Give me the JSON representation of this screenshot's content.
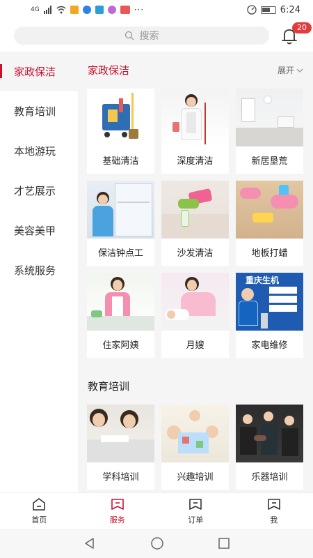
{
  "status_bar": {
    "time": "6:24",
    "network": "4G"
  },
  "search": {
    "placeholder": "搜索"
  },
  "notifications": {
    "count": "20"
  },
  "sidebar": {
    "items": [
      {
        "label": "家政保洁",
        "active": true
      },
      {
        "label": "教育培训",
        "active": false
      },
      {
        "label": "本地游玩",
        "active": false
      },
      {
        "label": "才艺展示",
        "active": false
      },
      {
        "label": "美容美甲",
        "active": false
      },
      {
        "label": "系统服务",
        "active": false
      }
    ]
  },
  "main": {
    "sections": [
      {
        "title": "家政保洁",
        "expand_label": "展开",
        "items": [
          {
            "label": "基础清洁"
          },
          {
            "label": "深度清洁"
          },
          {
            "label": "新居垦荒"
          },
          {
            "label": "保洁钟点工"
          },
          {
            "label": "沙发清洁"
          },
          {
            "label": "地板打蜡"
          },
          {
            "label": "住家阿姨"
          },
          {
            "label": "月嫂"
          },
          {
            "label": "家电维修"
          }
        ]
      },
      {
        "title": "教育培训",
        "items": [
          {
            "label": "学科培训"
          },
          {
            "label": "兴趣培训"
          },
          {
            "label": "乐器培训"
          }
        ]
      }
    ],
    "repair_banner_text": "重庆生机"
  },
  "bottom_nav": {
    "tabs": [
      {
        "label": "首页",
        "active": false
      },
      {
        "label": "服务",
        "active": true
      },
      {
        "label": "订单",
        "active": false
      },
      {
        "label": "我",
        "active": false
      }
    ]
  },
  "colors": {
    "accent": "#c8102e",
    "badge": "#e23b3b",
    "background": "#f5f5f5"
  }
}
